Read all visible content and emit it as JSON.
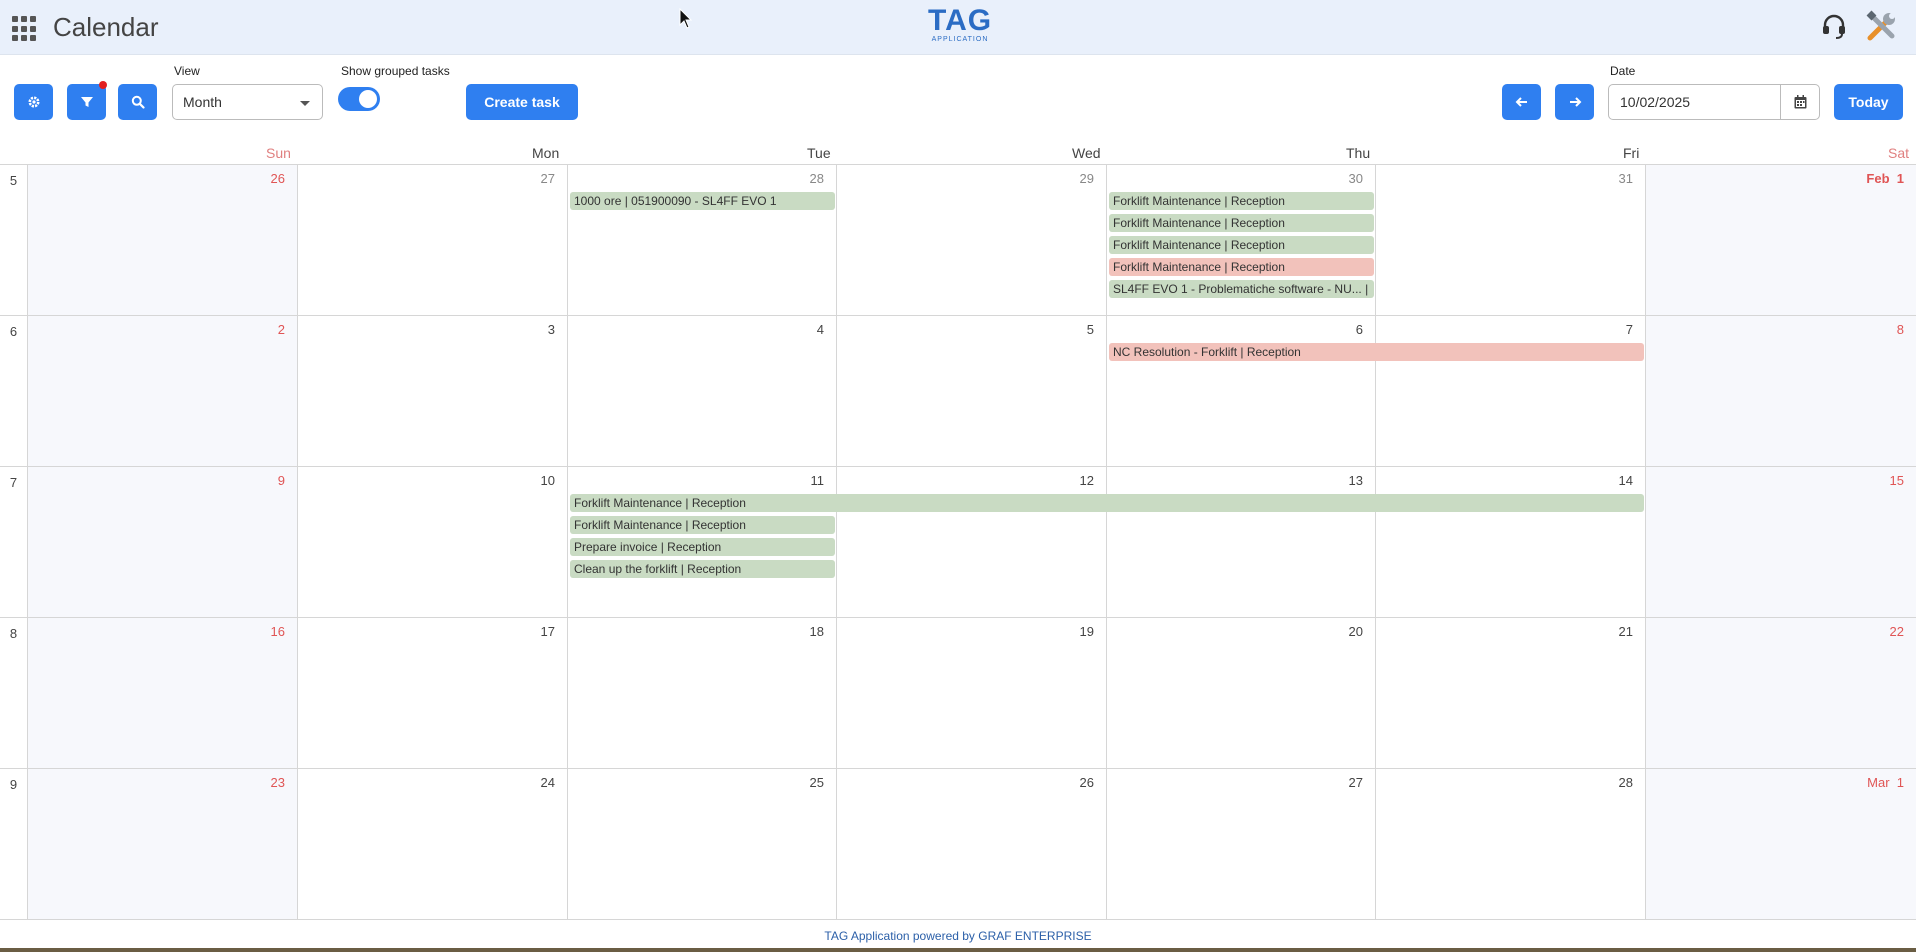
{
  "app": {
    "title": "Calendar",
    "logo_main": "TAG",
    "logo_sub": "APPLICATION"
  },
  "toolbar": {
    "view_label": "View",
    "view_value": "Month",
    "grouped_label": "Show grouped tasks",
    "create_label": "Create task",
    "date_label": "Date",
    "date_value": "10/02/2025",
    "today_label": "Today"
  },
  "days": [
    "Sun",
    "Mon",
    "Tue",
    "Wed",
    "Thu",
    "Fri",
    "Sat"
  ],
  "weeks": [
    {
      "num": "5",
      "dates": [
        "26",
        "27",
        "28",
        "29",
        "30",
        "31",
        "Feb  1"
      ]
    },
    {
      "num": "6",
      "dates": [
        "2",
        "3",
        "4",
        "5",
        "6",
        "7",
        "8"
      ]
    },
    {
      "num": "7",
      "dates": [
        "9",
        "10",
        "11",
        "12",
        "13",
        "14",
        "15"
      ]
    },
    {
      "num": "8",
      "dates": [
        "16",
        "17",
        "18",
        "19",
        "20",
        "21",
        "22"
      ]
    },
    {
      "num": "9",
      "dates": [
        "23",
        "24",
        "25",
        "26",
        "27",
        "28",
        "Mar  1"
      ]
    }
  ],
  "events": [
    {
      "label": "1000 ore | 051900090 - SL4FF EVO 1",
      "color": "green"
    },
    {
      "label": "Forklift Maintenance | Reception",
      "color": "green"
    },
    {
      "label": "Forklift Maintenance | Reception",
      "color": "green"
    },
    {
      "label": "Forklift Maintenance | Reception",
      "color": "green"
    },
    {
      "label": "Forklift Maintenance | Reception",
      "color": "red"
    },
    {
      "label": "SL4FF EVO 1 - Problematiche software - NU... |",
      "color": "green"
    },
    {
      "label": "NC Resolution - Forklift | Reception",
      "color": "red"
    },
    {
      "label": "Forklift Maintenance | Reception",
      "color": "green"
    },
    {
      "label": "Forklift Maintenance | Reception",
      "color": "green"
    },
    {
      "label": "Prepare invoice | Reception",
      "color": "green"
    },
    {
      "label": "Clean up the forklift | Reception",
      "color": "green"
    }
  ],
  "footer": "TAG Application powered by GRAF ENTERPRISE",
  "colors": {
    "accent": "#2f7ff0",
    "event_green": "#c9dbc3",
    "event_red": "#f2c2bb",
    "weekend_number": "#e05555"
  }
}
